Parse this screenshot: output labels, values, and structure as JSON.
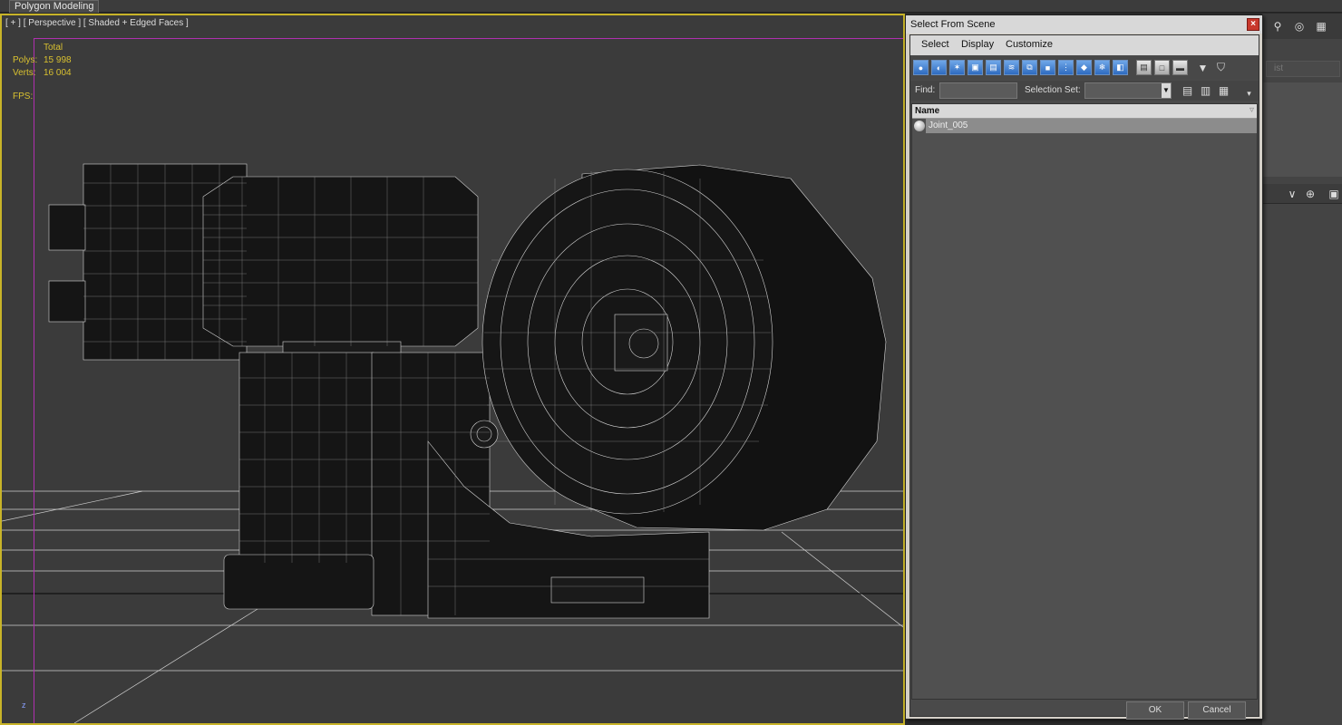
{
  "ribbon": {
    "tab_label": "Polygon Modeling"
  },
  "viewport": {
    "label": "[ + ] [ Perspective ] [ Shaded + Edged Faces ]",
    "stats": {
      "header": "Total",
      "polys_label": "Polys:",
      "polys_value": "15 998",
      "verts_label": "Verts:",
      "verts_value": "16 004",
      "fps_label": "FPS:"
    },
    "axis_label": "z"
  },
  "right_panel": {
    "field_text": "ist"
  },
  "dialog": {
    "title": "Select From Scene",
    "close_label": "×",
    "menu": {
      "select": "Select",
      "display": "Display",
      "customize": "Customize"
    },
    "find_label": "Find:",
    "find_value": "",
    "selection_set_label": "Selection Set:",
    "list": {
      "column_name": "Name",
      "rows": [
        {
          "label": "Joint_005"
        }
      ]
    },
    "ok_label": "OK",
    "cancel_label": "Cancel"
  },
  "colors": {
    "viewport_border": "#c8b428",
    "safe_frame": "#b030b0",
    "stats_text": "#d8c030",
    "selected_row": "#8c8c8c",
    "toolbar_blue": "#2e6bc0"
  }
}
